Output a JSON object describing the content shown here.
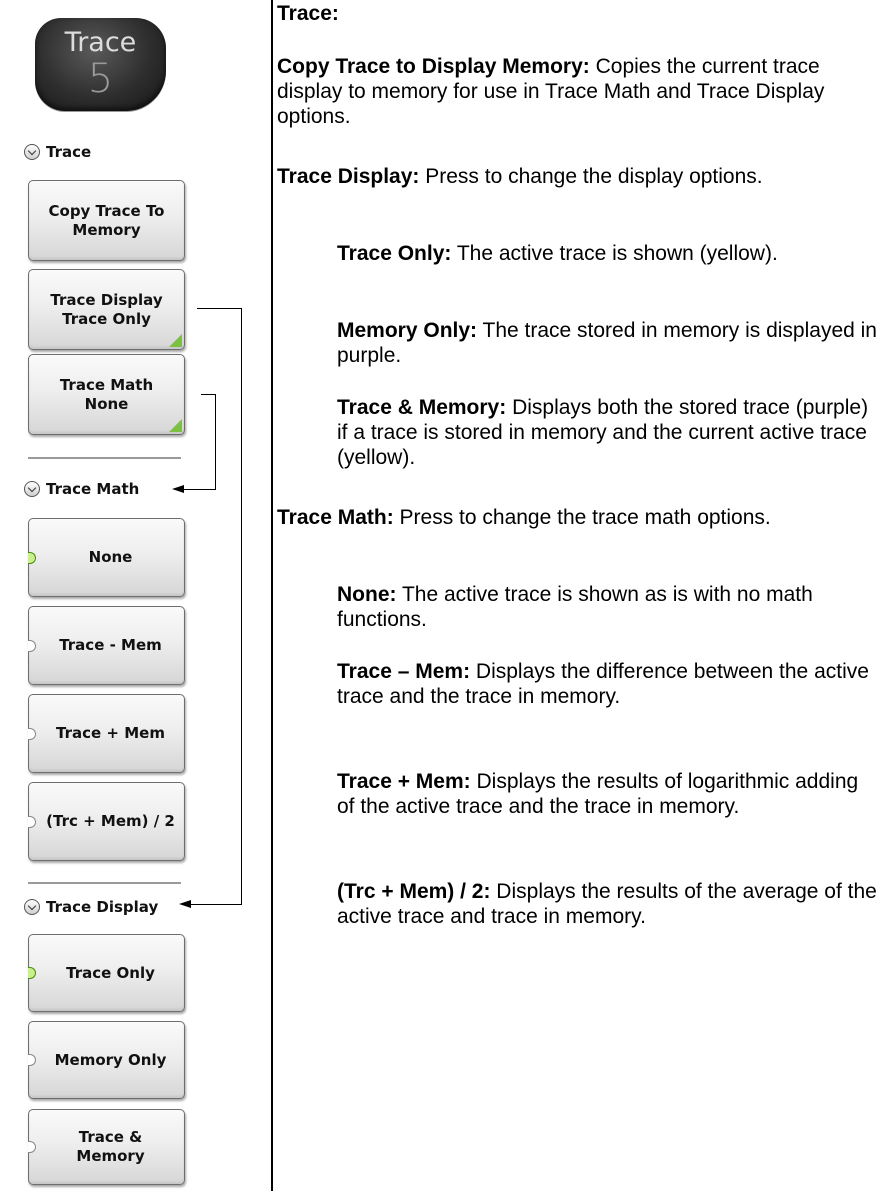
{
  "hardkey": {
    "title": "Trace",
    "number": "5"
  },
  "menus": {
    "trace": {
      "heading": "Trace",
      "keys": [
        {
          "line1": "Copy Trace To",
          "line2": "Memory"
        },
        {
          "line1": "Trace Display",
          "line2": "Trace Only"
        },
        {
          "line1": "Trace Math",
          "line2": "None"
        }
      ]
    },
    "trace_math": {
      "heading": "Trace Math",
      "keys": [
        "None",
        "Trace - Mem",
        "Trace + Mem",
        "(Trc + Mem) / 2"
      ],
      "selected": "None"
    },
    "trace_display": {
      "heading": "Trace Display",
      "keys": [
        {
          "line1": "Trace Only",
          "line2": ""
        },
        {
          "line1": "Memory Only",
          "line2": ""
        },
        {
          "line1": "Trace &",
          "line2": "Memory"
        }
      ],
      "selected": "Trace Only"
    }
  },
  "description": {
    "heading": "Trace:",
    "items": [
      {
        "term": "Copy Trace to Display Memory:",
        "text": "  Copies the current trace display to memory for use in Trace Math and Trace Display options."
      },
      {
        "term": "Trace Display:",
        "text": "  Press to change the display options."
      },
      {
        "term": "Trace Only:",
        "text": " The active trace is shown (yellow)."
      },
      {
        "term": "Memory Only:",
        "text": " The trace stored in memory is displayed in purple."
      },
      {
        "term": "Trace & Memory:",
        "text": " Displays both the stored trace (purple) if a trace is stored in memory and the current active trace (yellow)."
      },
      {
        "term": "Trace Math:",
        "text": "  Press to change the trace math options."
      },
      {
        "term": "None:",
        "text": " The active trace is shown as is with no math functions."
      },
      {
        "term": "Trace – Mem:",
        "text": " Displays the difference between the active trace and the trace in memory."
      },
      {
        "term": "Trace + Mem:",
        "text": " Displays the results of logarithmic adding of the active trace and the trace in memory."
      },
      {
        "term": "(Trc + Mem) / 2:",
        "text": " Displays the results of the average of the active trace and trace in memory."
      }
    ]
  },
  "colors": {
    "indicator_green": "#7bc142",
    "selected_dot": "#c9f08c",
    "key_face": "#eeeeee"
  }
}
